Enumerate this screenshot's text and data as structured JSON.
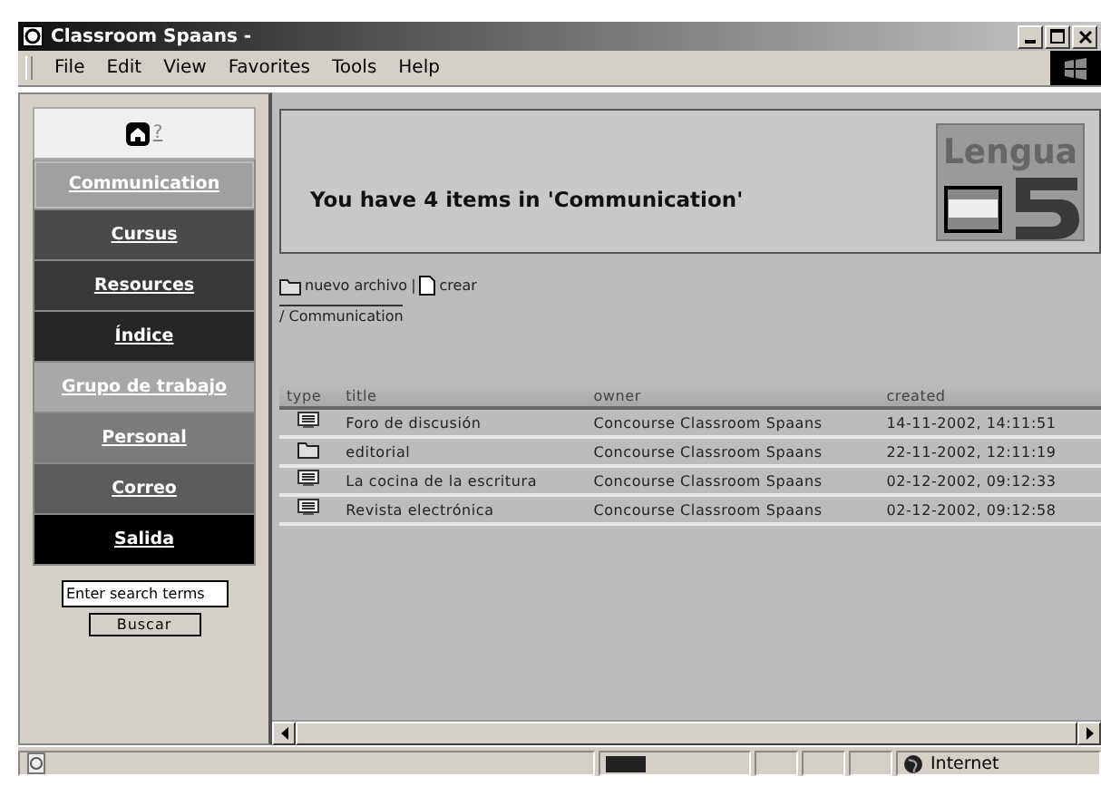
{
  "window": {
    "title": "Classroom Spaans -"
  },
  "menu": [
    {
      "label": "File"
    },
    {
      "label": "Edit"
    },
    {
      "label": "View"
    },
    {
      "label": "Favorites"
    },
    {
      "label": "Tools"
    },
    {
      "label": "Help"
    }
  ],
  "sidebar": {
    "help": "?",
    "items": [
      {
        "label": "Communication",
        "color": "#a0a0a0",
        "selected": true
      },
      {
        "label": "Cursus",
        "color": "#4a4a4a",
        "selected": false
      },
      {
        "label": "Resources",
        "color": "#383838",
        "selected": false
      },
      {
        "label": "Índice",
        "color": "#262626",
        "selected": false
      },
      {
        "label": "Grupo de trabajo",
        "color": "#a8a8a8",
        "selected": false
      },
      {
        "label": "Personal",
        "color": "#7c7c7c",
        "selected": false
      },
      {
        "label": "Correo",
        "color": "#5c5c5c",
        "selected": false
      },
      {
        "label": "Salida",
        "color": "#000000",
        "selected": false
      }
    ],
    "search": {
      "placeholder": "Enter search terms",
      "button": "Buscar"
    }
  },
  "header": {
    "title": "You have 4 items in 'Communication'",
    "logo": "Lengua"
  },
  "actions": [
    {
      "kind": "folder",
      "label": "nuevo archivo"
    },
    {
      "kind": "page",
      "label": "crear"
    }
  ],
  "separator": "|",
  "breadcrumb": "/ Communication",
  "table": {
    "columns": [
      "type",
      "title",
      "owner",
      "created"
    ],
    "rows": [
      {
        "kind": "forum",
        "title": "Foro de discusión",
        "owner": "Concourse Classroom Spaans",
        "created": "14-11-2002, 14:11:51"
      },
      {
        "kind": "folder",
        "title": "editorial",
        "owner": "Concourse Classroom Spaans",
        "created": "22-11-2002, 12:11:19"
      },
      {
        "kind": "forum",
        "title": "La cocina de la escritura",
        "owner": "Concourse Classroom Spaans",
        "created": "02-12-2002, 09:12:33"
      },
      {
        "kind": "forum",
        "title": "Revista electrónica",
        "owner": "Concourse Classroom Spaans",
        "created": "02-12-2002, 09:12:58"
      }
    ]
  },
  "status_bar": {
    "zone": "Internet"
  }
}
